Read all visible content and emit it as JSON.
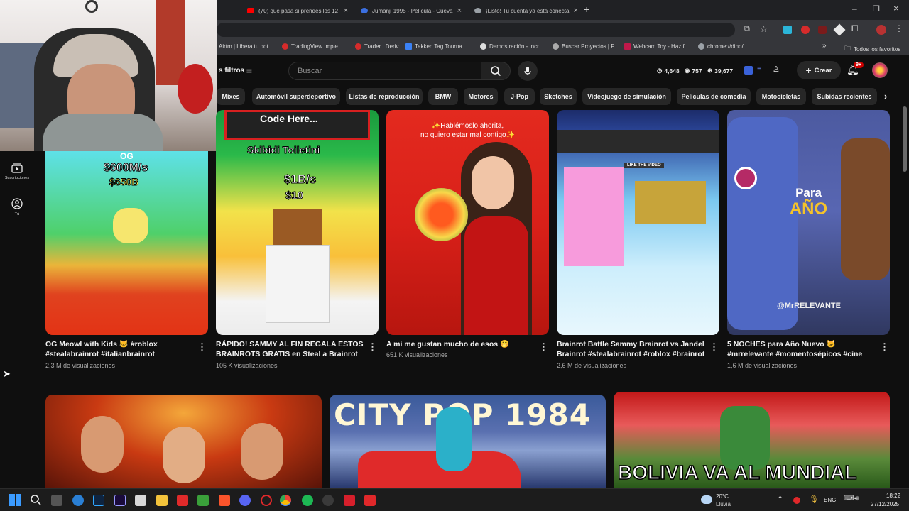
{
  "browser": {
    "tabs": [
      {
        "title": "(70) que pasa si prendes los 12",
        "color": "#ff0000"
      },
      {
        "title": "Jumanji 1995 - Película - Cueva",
        "color": "#3b6fe0"
      },
      {
        "title": "¡Listo! Tu cuenta ya está conecta",
        "color": "#9aa0a6"
      }
    ],
    "new_tab": "+",
    "bookmarks": [
      "Airtm | Libera tu pot...",
      "TradingView Imple...",
      "Trader | Deriv",
      "Tekken Tag Tourna...",
      "Demostración - Incr...",
      "Buscar Proyectos | F...",
      "Webcam Toy - Haz f...",
      "chrome://dino/"
    ],
    "bookmarks_more": "»",
    "all_favorites": "Todos los favoritos"
  },
  "youtube": {
    "filters_label": "s filtros",
    "search_placeholder": "Buscar",
    "stats": [
      "4,648",
      "757",
      "39,677"
    ],
    "create_label": "Crear",
    "notif_badge": "9+",
    "chips": [
      "Mixes",
      "Automóvil superdeportivo",
      "Listas de reproducción",
      "BMW",
      "Motores",
      "J-Pop",
      "Sketches",
      "Videojuego de simulación",
      "Películas de comedia",
      "Motocicletas",
      "Subidas recientes"
    ],
    "sidebar": [
      {
        "label": "Suscripciones",
        "icon": "subscriptions-icon"
      },
      {
        "label": "Tú",
        "icon": "you-icon"
      }
    ],
    "shorts": [
      {
        "title": "OG Meowl with Kids 🐱 #roblox #stealabrainrot #italianbrainrot",
        "views": "2,3 M de visualizaciones",
        "overlay": [
          "OG",
          "$600M/s",
          "$650B"
        ]
      },
      {
        "title": "RÁPIDO! SAMMY AL FIN REGALA ESTOS BRAINROTS GRATIS en Steal a Brainrot",
        "views": "105 K visualizaciones",
        "overlay": [
          "Code Here...",
          "Skibidi Toiletini",
          "$1B/s",
          "$10"
        ]
      },
      {
        "title": "A mi me gustan mucho de esos 🤭",
        "views": "651 K visualizaciones",
        "overlay": [
          "✨Hablémoslo ahorita,",
          "no quiero estar mal contigo✨"
        ]
      },
      {
        "title": "Brainrot Battle Sammy Brainrot vs Jandel Brainrot #stealabrainrot #roblox #brainrot",
        "views": "2,6 M de visualizaciones",
        "overlay": [
          "LIKE THE VIDEO"
        ]
      },
      {
        "title": "5 NOCHES para Año Nuevo 🐱 #mrrelevante #momentosépicos #cine",
        "views": "1,6 M de visualizaciones",
        "overlay": [
          "Para",
          "AÑO",
          "@MrRELEVANTE"
        ]
      }
    ],
    "videos_row2": [
      {
        "overlay": ""
      },
      {
        "overlay": "CITY POP 1984"
      },
      {
        "overlay": "BOLIVIA VA AL MUNDIAL"
      }
    ]
  },
  "taskbar": {
    "weather_temp": "20°C",
    "weather_desc": "Lluvia",
    "lang": "ENG",
    "time": "18:22",
    "date": "27/12/2025"
  }
}
